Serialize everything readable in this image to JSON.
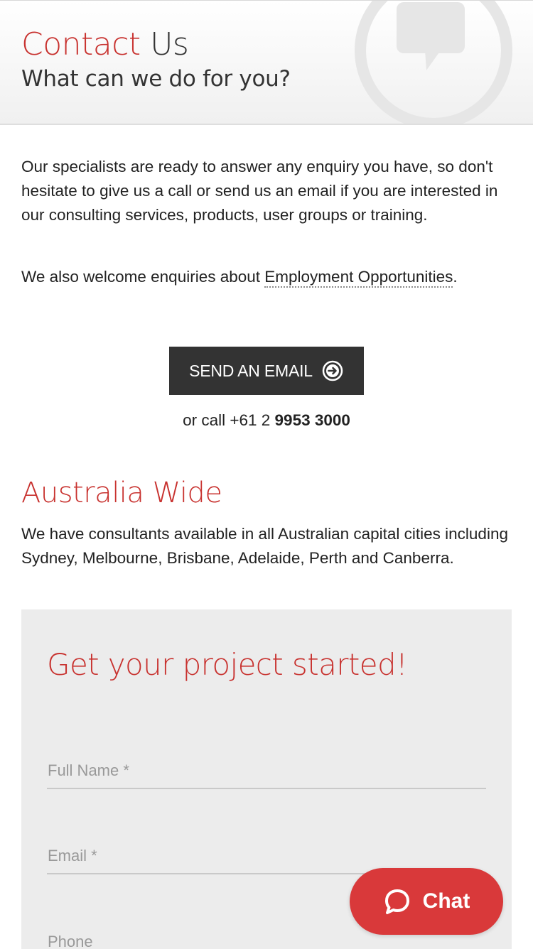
{
  "hero": {
    "title_red": "Contact",
    "title_dark": "Us",
    "subtitle": "What can we do for you?"
  },
  "intro": {
    "paragraph": "Our specialists are ready to answer any enquiry you have, so don't hesitate to give us a call or send us an email if you are interested in our consulting services, products, user groups or training.",
    "employment_prefix": "We also welcome enquiries about ",
    "employment_link": "Employment Opportunities",
    "employment_suffix": "."
  },
  "email_button": {
    "label": "SEND AN EMAIL",
    "icon": "arrow-circle-right-icon"
  },
  "call": {
    "prefix": "or call +61 2 ",
    "number": "9953 3000"
  },
  "australia": {
    "heading": "Australia Wide",
    "paragraph": "We have consultants available in all Australian capital cities including Sydney, Melbourne, Brisbane, Adelaide, Perth and Canberra."
  },
  "form": {
    "title": "Get your project started!",
    "full_name_placeholder": "Full Name *",
    "email_placeholder": "Email *",
    "phone_placeholder": "Phone"
  },
  "chat": {
    "label": "Chat",
    "icon": "speech-bubble-icon"
  },
  "colors": {
    "accent_red": "#c8322f",
    "chat_red": "#d9393a",
    "button_dark": "#333333",
    "form_bg": "#ececec"
  }
}
